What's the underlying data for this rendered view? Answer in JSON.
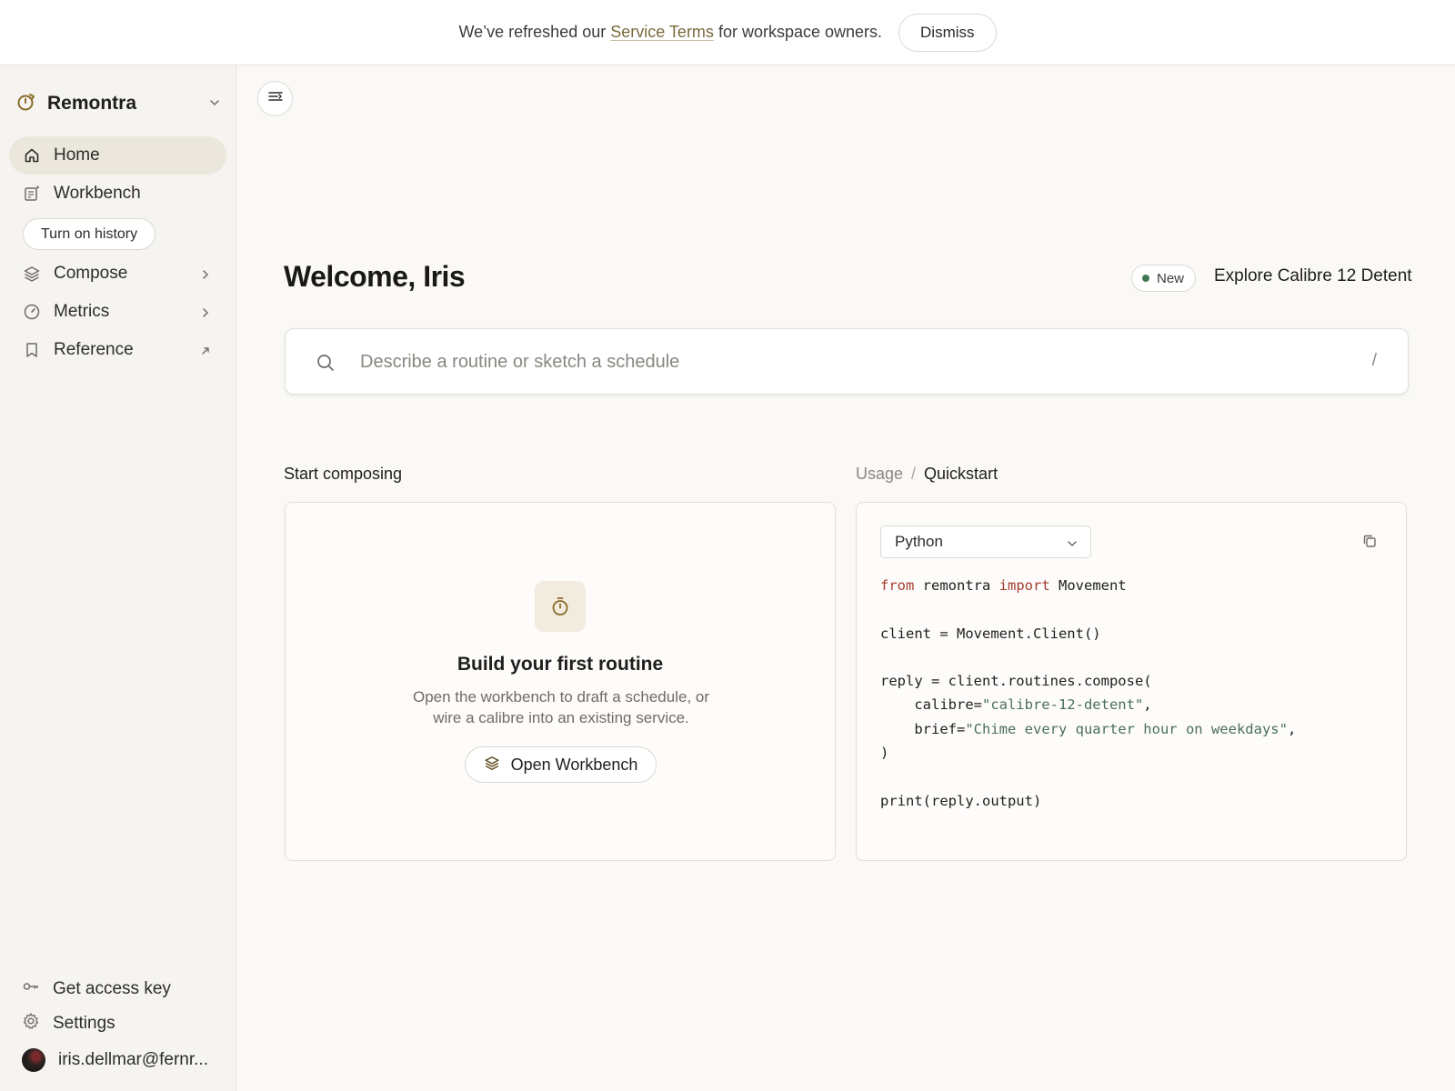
{
  "banner": {
    "text_before": "We’ve refreshed our ",
    "link": "Service Terms",
    "text_after": " for workspace owners.",
    "dismiss_label": "Dismiss"
  },
  "sidebar": {
    "brand": "Remontra",
    "nav": [
      {
        "label": "Home",
        "icon": "home-icon",
        "active": true
      },
      {
        "label": "Workbench",
        "icon": "workbench-icon"
      },
      {
        "label": "Compose",
        "icon": "layers-icon",
        "trailing": "chevron-right-icon"
      },
      {
        "label": "Metrics",
        "icon": "gauge-icon",
        "trailing": "chevron-right-icon"
      },
      {
        "label": "Reference",
        "icon": "bookmark-icon",
        "trailing": "external-arrow-icon"
      }
    ],
    "history_button": "Turn on history",
    "footer": {
      "access_key": "Get access key",
      "settings": "Settings",
      "user_email": "iris.dellmar@fernr..."
    }
  },
  "main": {
    "welcome": "Welcome, Iris",
    "badge": "New",
    "explore_link": "Explore Calibre 12 Detent",
    "search": {
      "placeholder": "Describe a routine or sketch a schedule",
      "shortcut": "/"
    },
    "start_section": {
      "title": "Start composing",
      "card_title": "Build your first routine",
      "card_desc_line1": "Open the workbench to draft a schedule, or",
      "card_desc_line2": "wire a calibre into an existing service.",
      "button": "Open Workbench"
    },
    "quickstart": {
      "breadcrumb_parent": "Usage",
      "breadcrumb_separator": "/",
      "breadcrumb_current": "Quickstart",
      "language": "Python",
      "code": {
        "l1_from": "from",
        "l1_mod": " remontra ",
        "l1_import": "import",
        "l1_name": " Movement",
        "l3": "client = Movement.Client()",
        "l5": "reply = client.routines.compose(",
        "l6_key": "    calibre=",
        "l6_val": "\"calibre-12-detent\"",
        "l6_end": ",",
        "l7_key": "    brief=",
        "l7_val": "\"Chime every quarter hour on weekdays\"",
        "l7_end": ",",
        "l8": ")",
        "l10": "print(reply.output)"
      }
    }
  },
  "colors": {
    "accent": "#7a6a3c",
    "active_nav": "#ebe7dd",
    "badge_dot": "#3f7a52",
    "keyword": "#a23c2e",
    "string": "#4b6f5a"
  }
}
